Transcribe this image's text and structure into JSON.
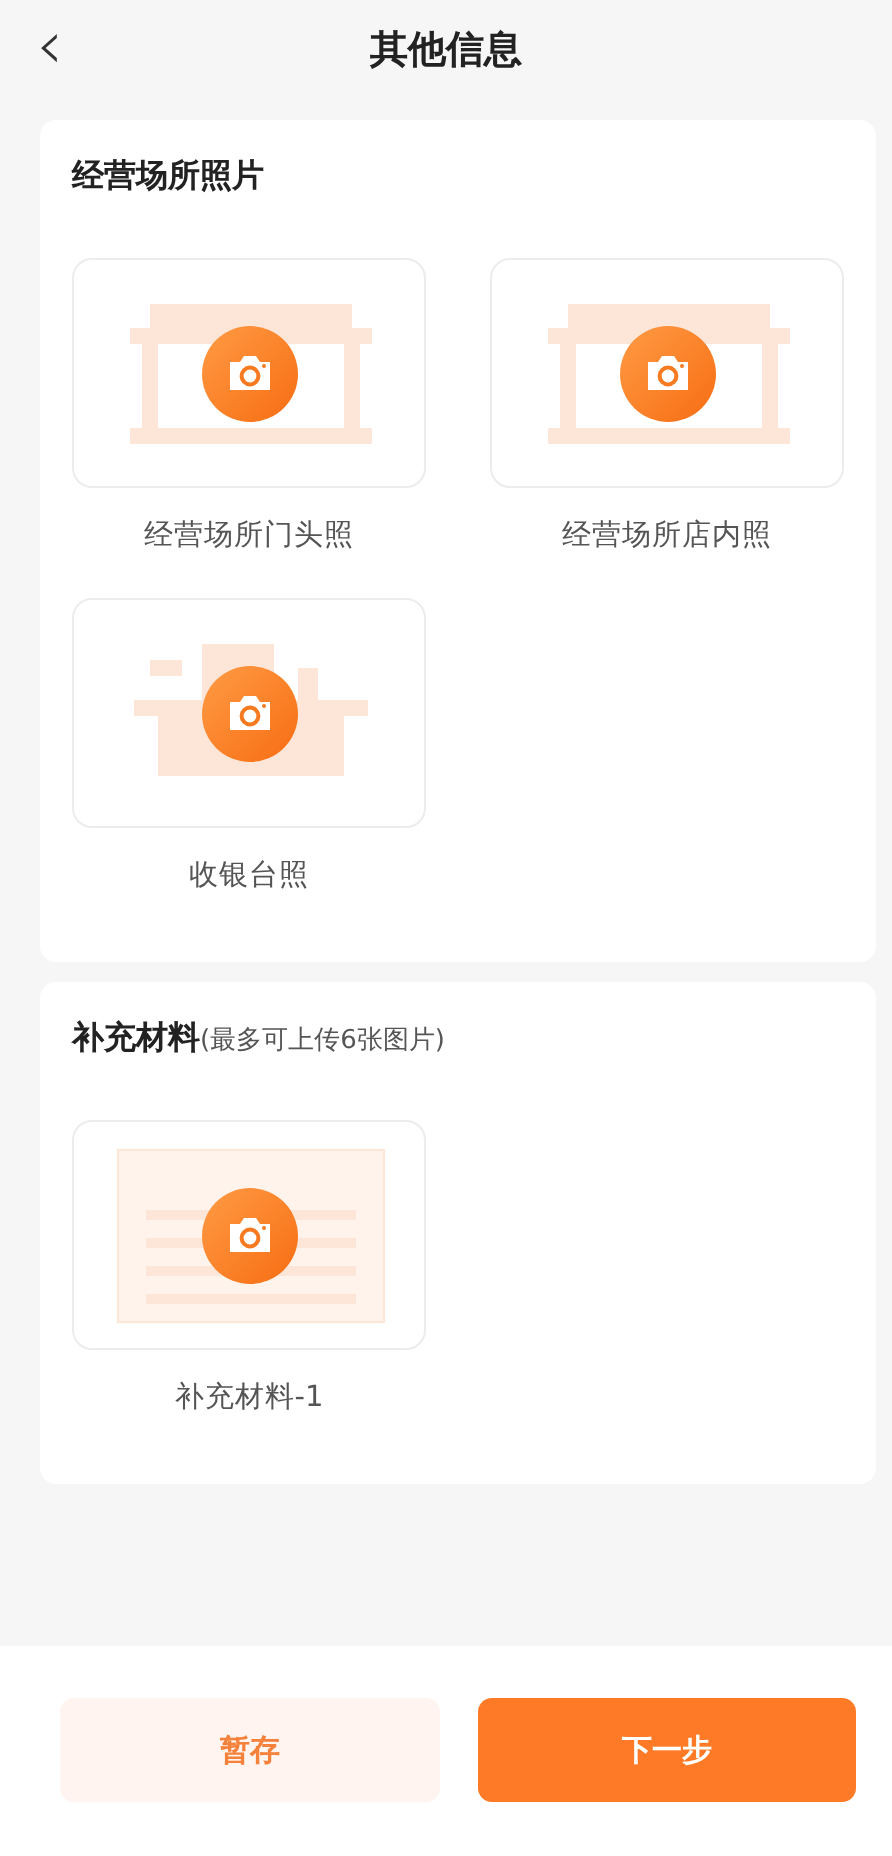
{
  "header": {
    "back_icon": "‹",
    "title": "其他信息"
  },
  "sections": [
    {
      "title": "经营场所照片",
      "tiles": [
        {
          "kind": "storefront",
          "label": "经营场所门头照"
        },
        {
          "kind": "storefront",
          "label": "经营场所店内照"
        },
        {
          "kind": "counter",
          "label": "收银台照"
        }
      ]
    },
    {
      "title": "补充材料",
      "note": "(最多可上传6张图片)",
      "tiles": [
        {
          "kind": "document",
          "label": "补充材料-1"
        }
      ]
    }
  ],
  "buttons": [
    {
      "kind": "secondary",
      "label": "暂存"
    },
    {
      "kind": "primary",
      "label": "下一步"
    }
  ]
}
